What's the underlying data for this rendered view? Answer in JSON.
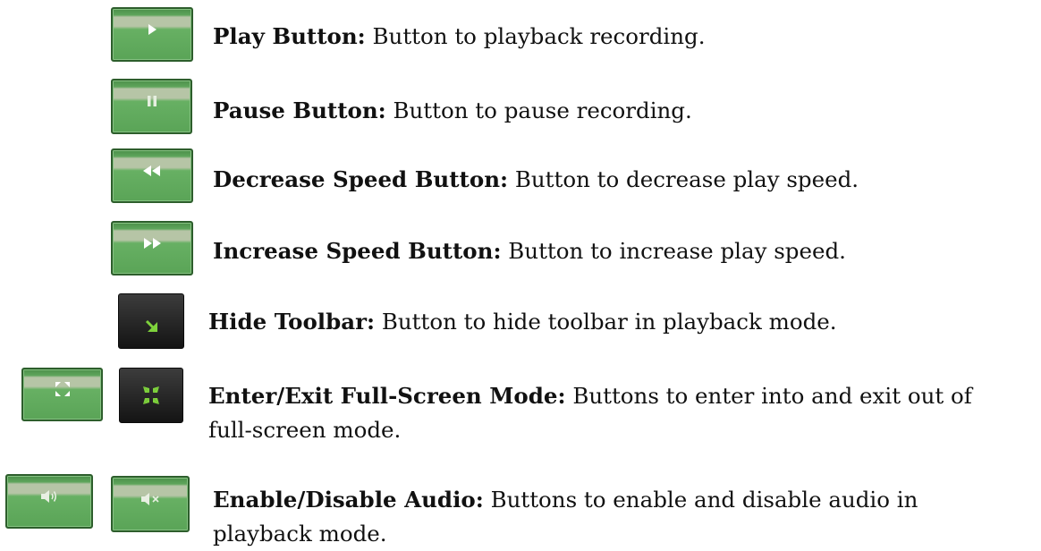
{
  "items": [
    {
      "label": "Play Button:",
      "text": "Button to playback recording."
    },
    {
      "label": "Pause Button:",
      "text": "Button to pause recording."
    },
    {
      "label": "Decrease Speed Button:",
      "text": "Button to decrease play speed."
    },
    {
      "label": "Increase Speed Button:",
      "text": "Button to increase play speed."
    },
    {
      "label": "Hide Toolbar:",
      "text": "Button to hide toolbar in playback mode."
    },
    {
      "label": "Enter/Exit Full-Screen Mode:",
      "text": "Buttons to enter into and exit out of",
      "text2": "full-screen mode."
    },
    {
      "label": "Enable/Disable Audio:",
      "text": "Buttons to enable and disable audio in",
      "text2": "playback mode."
    }
  ],
  "colors": {
    "button_green": "#5ea55b",
    "button_dark": "#1c1c1c",
    "arrow_green": "#7ed23c"
  }
}
